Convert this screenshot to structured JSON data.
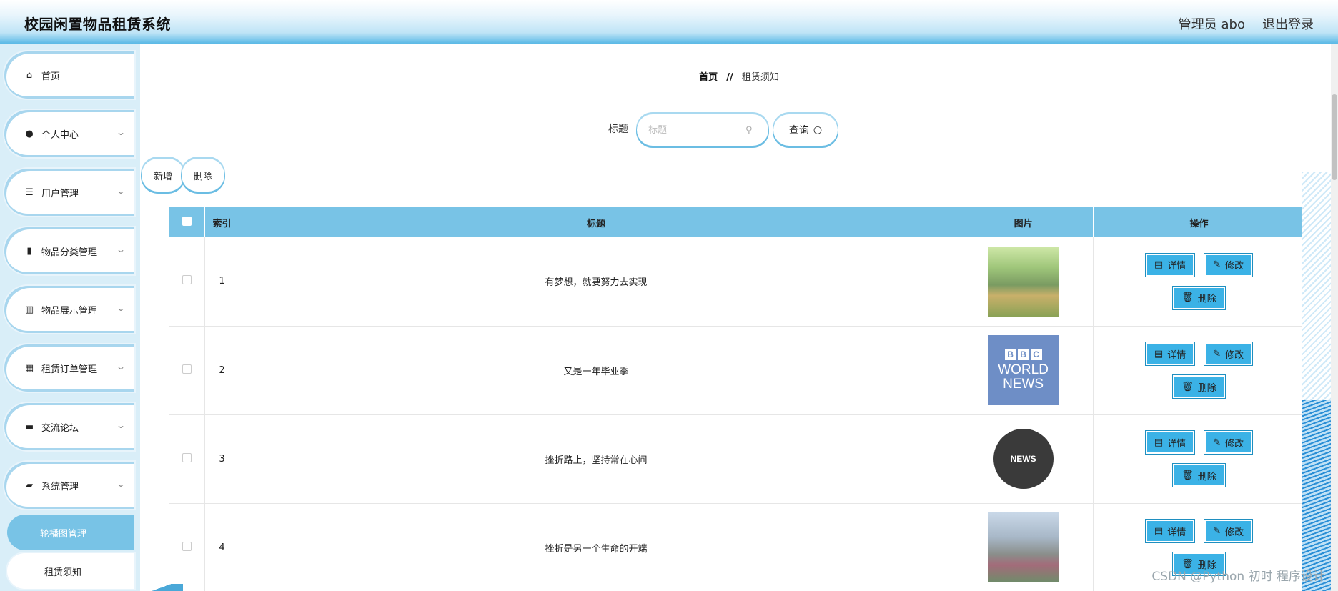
{
  "header": {
    "title": "校园闲置物品租赁系统",
    "user_label": "管理员 abo",
    "logout_label": "退出登录"
  },
  "sidebar": {
    "items": [
      {
        "label": "首页",
        "icon": "home-icon",
        "has_chevron": false
      },
      {
        "label": "个人中心",
        "icon": "user-icon",
        "has_chevron": true
      },
      {
        "label": "用户管理",
        "icon": "list-icon",
        "has_chevron": true
      },
      {
        "label": "物品分类管理",
        "icon": "clipboard-icon",
        "has_chevron": true
      },
      {
        "label": "物品展示管理",
        "icon": "bar-chart-icon",
        "has_chevron": true
      },
      {
        "label": "租赁订单管理",
        "icon": "grid-icon",
        "has_chevron": true
      },
      {
        "label": "交流论坛",
        "icon": "chat-icon",
        "has_chevron": true
      },
      {
        "label": "系统管理",
        "icon": "folder-icon",
        "has_chevron": true
      }
    ],
    "sub_items": [
      {
        "label": "轮播图管理",
        "active": true
      },
      {
        "label": "租赁须知",
        "active": false
      }
    ]
  },
  "breadcrumb": {
    "home": "首页",
    "separator": "//",
    "current": "租赁须知"
  },
  "search": {
    "label": "标题",
    "placeholder": "标题",
    "value": "",
    "button_label": "查询"
  },
  "actions": {
    "add_label": "新增",
    "delete_label": "删除"
  },
  "table": {
    "columns": [
      "索引",
      "标题",
      "图片",
      "操作"
    ],
    "rows": [
      {
        "index": "1",
        "title": "有梦想，就要努力去实现",
        "image": "campus-building-photo"
      },
      {
        "index": "2",
        "title": "又是一年毕业季",
        "image": "bbc-world-news-logo"
      },
      {
        "index": "3",
        "title": "挫折路上，坚持常在心间",
        "image": "news-globe-icon"
      },
      {
        "index": "4",
        "title": "挫折是另一个生命的开端",
        "image": "campus-plaza-photo"
      }
    ],
    "row_actions": {
      "detail": "详情",
      "edit": "修改",
      "delete": "删除"
    }
  },
  "thumb_text": {
    "bbc_letters": [
      "B",
      "B",
      "C"
    ],
    "bbc_line1": "WORLD",
    "bbc_line2": "NEWS",
    "news_badge": "NEWS"
  },
  "watermark": "CSDN @Python 初时 程序设计",
  "colors": {
    "accent": "#78c3e6",
    "button_blue": "#3bb2e6",
    "sidebar_bg": "#d9eef8"
  }
}
